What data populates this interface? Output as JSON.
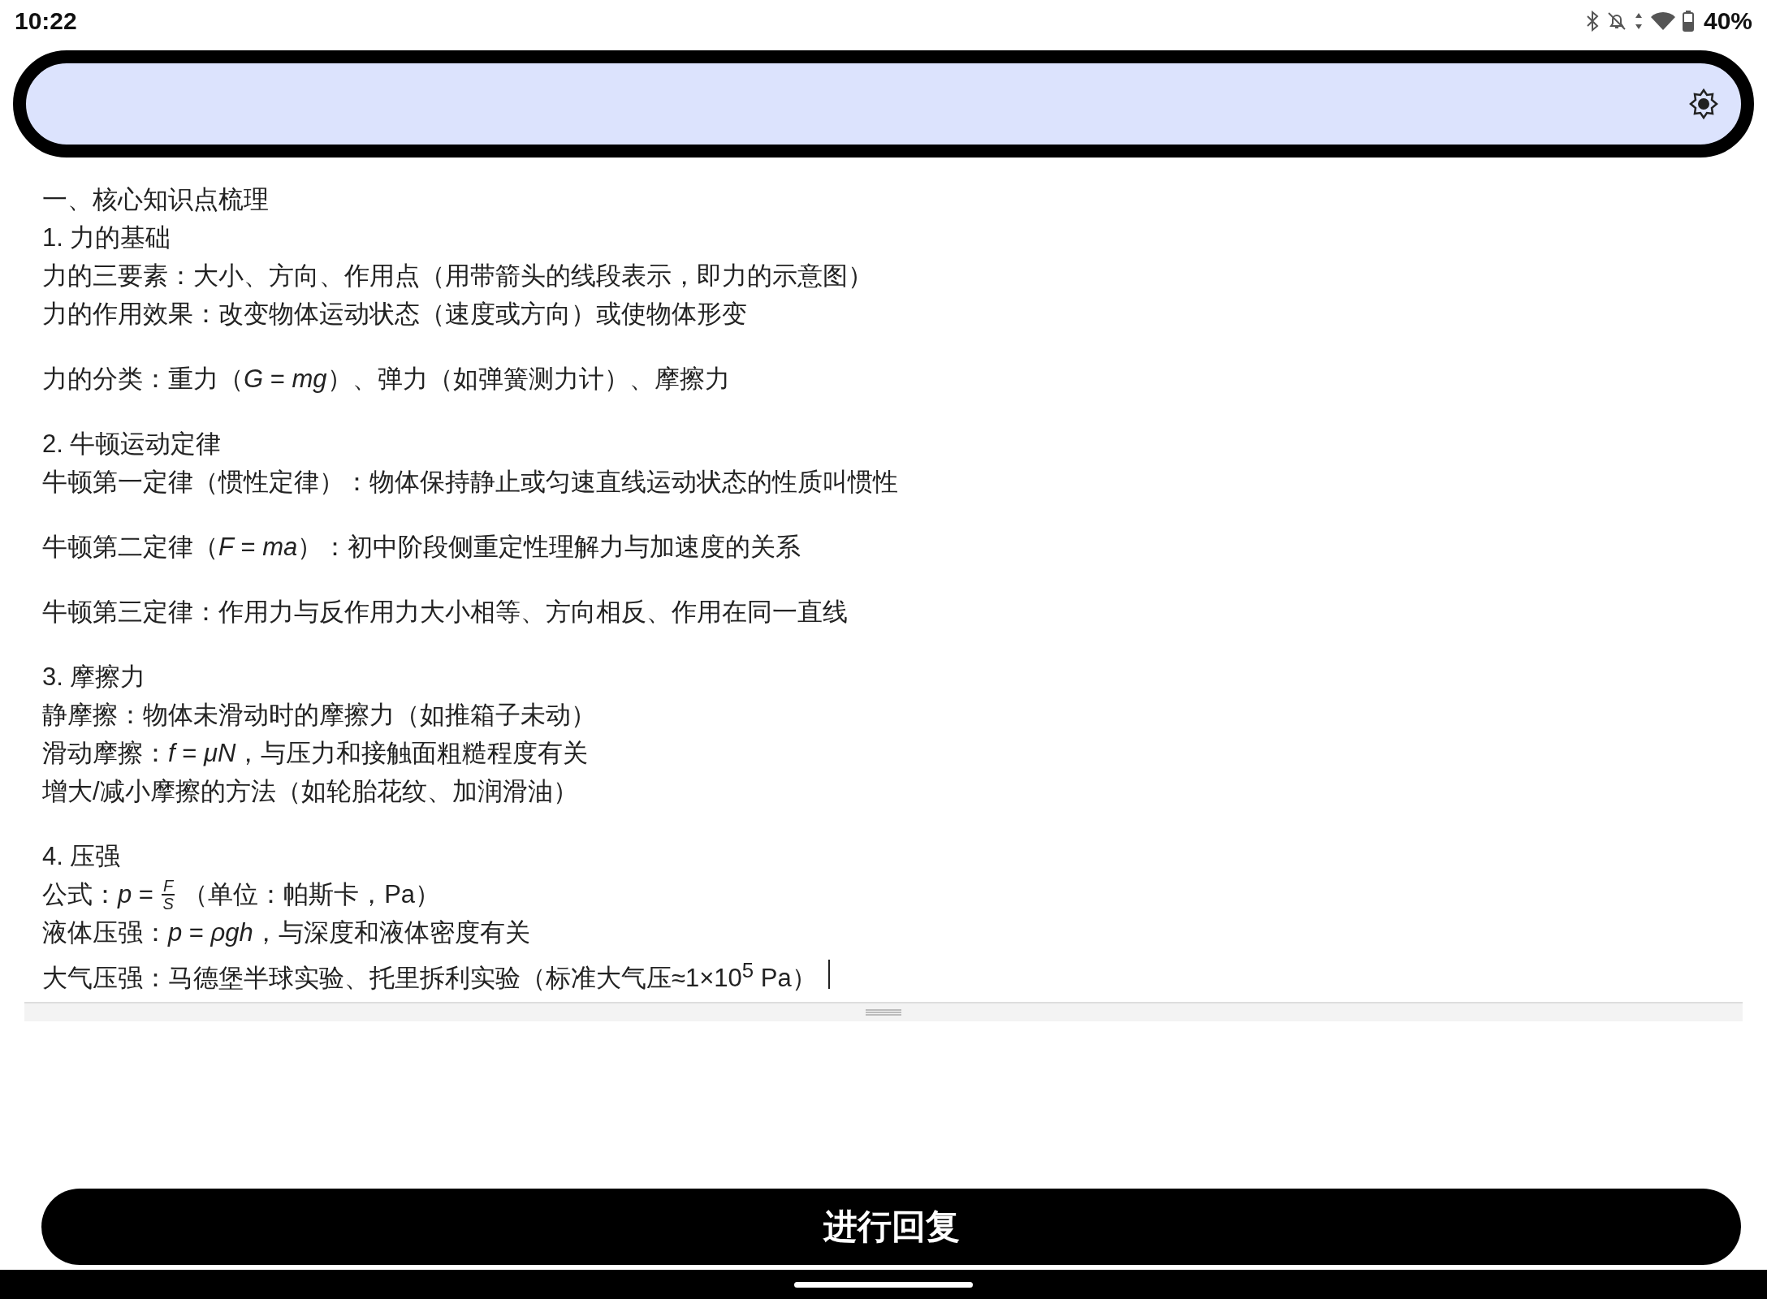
{
  "status_bar": {
    "time": "10:22",
    "battery": "40%"
  },
  "editor": {
    "caret_visible": true,
    "paragraphs": [
      {
        "lines": [
          {
            "kind": "text",
            "text": "一、核心知识点梳理"
          },
          {
            "kind": "text",
            "text": "1. 力的基础"
          },
          {
            "kind": "text",
            "text": "力的三要素：大小、方向、作用点（用带箭头的线段表示，即力的示意图）"
          },
          {
            "kind": "text",
            "text": "力的作用效果：改变物体运动状态（速度或方向）或使物体形变"
          }
        ]
      },
      {
        "lines": [
          {
            "kind": "text",
            "text": "力的分类：重力（*G* = *mg*）、弹力（如弹簧测力计）、摩擦力"
          }
        ]
      },
      {
        "lines": [
          {
            "kind": "text",
            "text": "2. 牛顿运动定律"
          },
          {
            "kind": "text",
            "text": "牛顿第一定律（惯性定律）：物体保持静止或匀速直线运动状态的性质叫惯性"
          }
        ]
      },
      {
        "lines": [
          {
            "kind": "text",
            "text": "牛顿第二定律（*F* = *ma*）：初中阶段侧重定性理解力与加速度的关系"
          }
        ]
      },
      {
        "lines": [
          {
            "kind": "text",
            "text": "牛顿第三定律：作用力与反作用力大小相等、方向相反、作用在同一直线"
          }
        ]
      },
      {
        "lines": [
          {
            "kind": "text",
            "text": "3. 摩擦力"
          },
          {
            "kind": "text",
            "text": "静摩擦：物体未滑动时的摩擦力（如推箱子未动）"
          },
          {
            "kind": "text",
            "text": "滑动摩擦：*f* = *μN*，与压力和接触面粗糙程度有关"
          },
          {
            "kind": "text",
            "text": "增大/减小摩擦的方法（如轮胎花纹、加润滑油）"
          }
        ]
      },
      {
        "lines": [
          {
            "kind": "text",
            "text": "4. 压强"
          },
          {
            "kind": "fraction",
            "before": "公式：*p* =",
            "numerator": "F",
            "denominator": "S",
            "after": "（单位：帕斯卡，Pa）"
          },
          {
            "kind": "text",
            "text": "液体压强：*p* = *ρgh*，与深度和液体密度有关"
          },
          {
            "kind": "text",
            "text": "大气压强：马德堡半球实验、托里拆利实验（标准大气压≈1×10$^{5}$ Pa）"
          }
        ]
      }
    ]
  },
  "reply_button": {
    "label": "进行回复"
  }
}
